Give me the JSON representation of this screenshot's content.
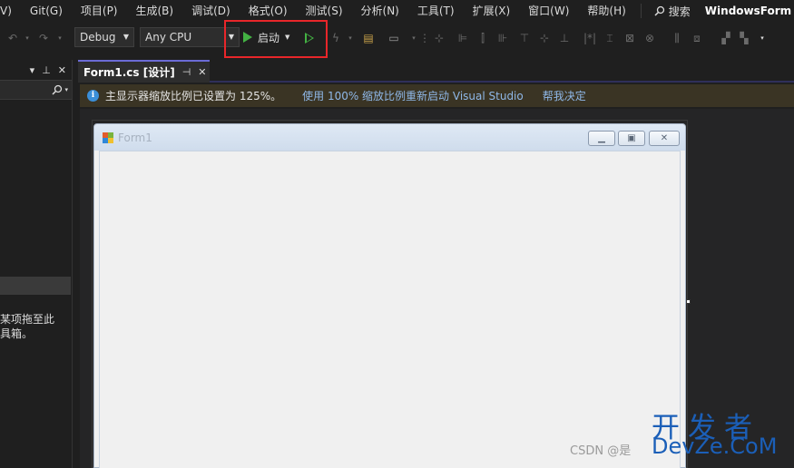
{
  "menubar": {
    "items": [
      "V)",
      "Git(G)",
      "项目(P)",
      "生成(B)",
      "调试(D)",
      "格式(O)",
      "测试(S)",
      "分析(N)",
      "工具(T)",
      "扩展(X)",
      "窗口(W)",
      "帮助(H)"
    ],
    "search_label": "搜索",
    "solution_title": "WindowsForm"
  },
  "toolbar": {
    "config": "Debug",
    "platform": "Any CPU",
    "start_label": "启动",
    "highlight_color": "#e8262a",
    "start_color": "#43b243"
  },
  "left_panel": {
    "hint_text": "某项拖至此\n具箱。"
  },
  "document": {
    "tab_title": "Form1.cs [设计]"
  },
  "infobar": {
    "message": "主显示器缩放比例已设置为 125%。",
    "link_restart": "使用 100% 缩放比例重新启动 Visual Studio",
    "link_decide": "帮我决定"
  },
  "form": {
    "title": "Form1"
  },
  "watermark": {
    "kaifa": "开发者",
    "csdn": "CSDN @是",
    "devze": "DevZe.CoM"
  }
}
